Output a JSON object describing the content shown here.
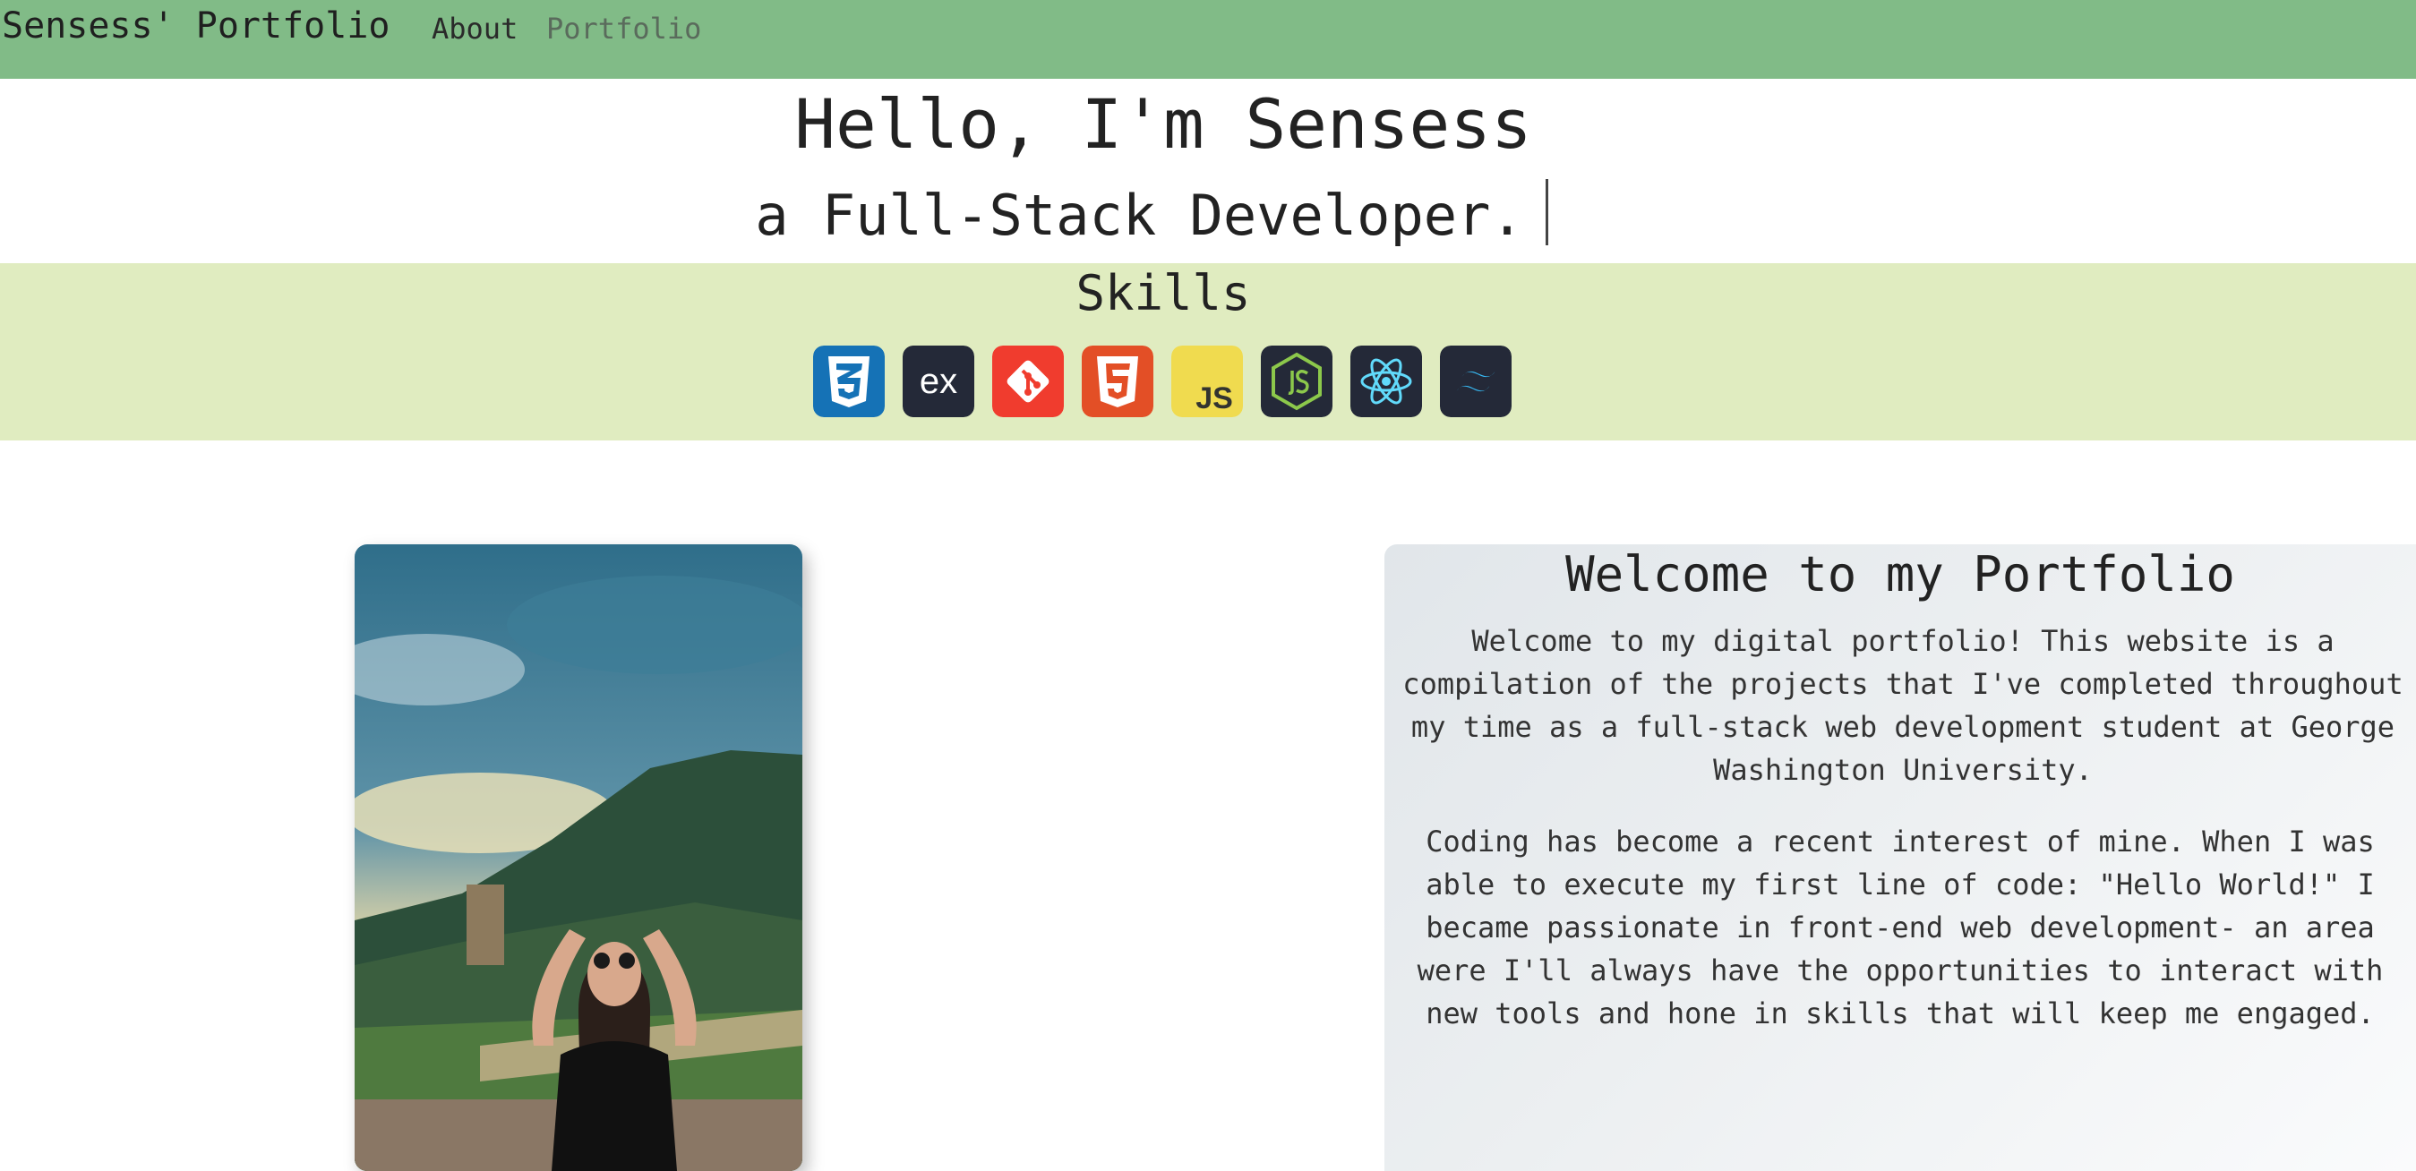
{
  "nav": {
    "brand": "Sensess' Portfolio",
    "links": [
      {
        "label": "About"
      },
      {
        "label": "Portfolio"
      }
    ]
  },
  "hero": {
    "title": "Hello, I'm Sensess",
    "subtitle": "a Full-Stack Developer."
  },
  "skills": {
    "title": "Skills",
    "icons": [
      {
        "name": "css3-icon",
        "color": "#1572b6"
      },
      {
        "name": "express-icon",
        "color": "#242938",
        "text": "ex"
      },
      {
        "name": "git-icon",
        "color": "#f03c2e"
      },
      {
        "name": "html5-icon",
        "color": "#e34f26"
      },
      {
        "name": "javascript-icon",
        "color": "#f0db4f",
        "text": "JS"
      },
      {
        "name": "nodejs-icon",
        "color": "#242938"
      },
      {
        "name": "react-icon",
        "color": "#242938"
      },
      {
        "name": "tailwind-icon",
        "color": "#242938"
      }
    ]
  },
  "welcome": {
    "title": "Welcome to my Portfolio",
    "paragraph1": "Welcome to my digital portfolio! This website is a compilation of the projects that I've completed throughout my time as a full-stack web development student at George Washington University.",
    "paragraph2": "Coding has become a recent interest of mine. When I was able to execute my first line of code: \"Hello World!\" I became passionate in front-end web development- an area were I'll always have the opportunities to interact with new tools and hone in skills that will keep me engaged."
  },
  "colors": {
    "navbar": "#81bb87",
    "skills_band": "#e0ecc0",
    "card": "#eceff1"
  }
}
